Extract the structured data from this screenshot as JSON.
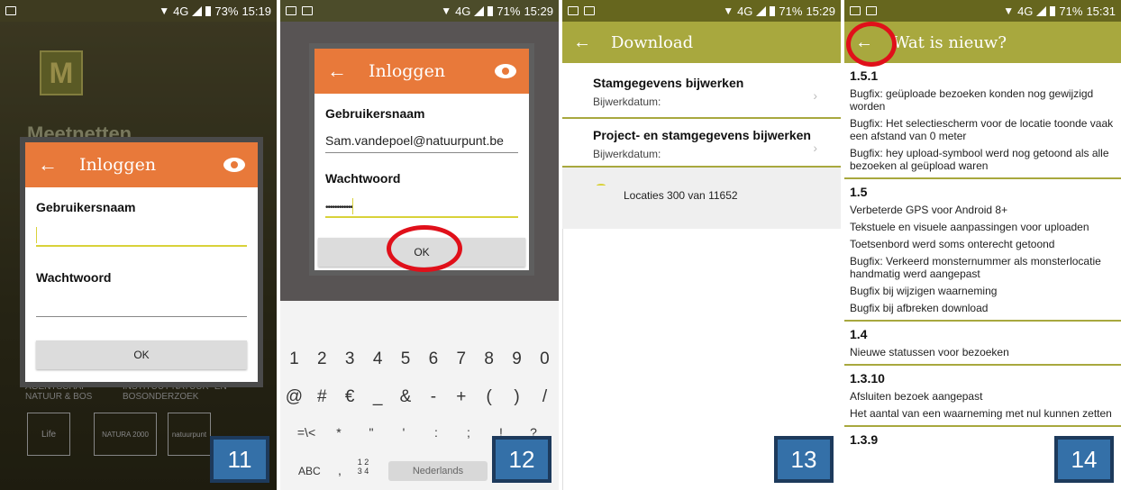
{
  "status_bars": [
    {
      "battery": "73%",
      "time": "15:19",
      "network": "4G"
    },
    {
      "battery": "71%",
      "time": "15:29",
      "network": "4G"
    },
    {
      "battery": "71%",
      "time": "15:29",
      "network": "4G"
    },
    {
      "battery": "71%",
      "time": "15:31",
      "network": "4G"
    }
  ],
  "panel1": {
    "tag": "11",
    "app_logo": "M",
    "app_title": "Meetnetten",
    "org_left": "AGENTSCHAP NATUUR & BOS",
    "org_right": "INSTITUUT NATUUR- EN BOSONDERZOEK",
    "badge1": "Life",
    "badge2": "NATURA 2000",
    "badge3": "natuurpunt",
    "dialog": {
      "back": "←",
      "title": "Inloggen",
      "username_label": "Gebruikersnaam",
      "username_value": "",
      "password_label": "Wachtwoord",
      "password_value": "",
      "ok_label": "OK"
    }
  },
  "panel2": {
    "tag": "12",
    "dialog": {
      "back": "←",
      "title": "Inloggen",
      "username_label": "Gebruikersnaam",
      "username_value": "Sam.vandepoel@natuurpunt.be",
      "password_label": "Wachtwoord",
      "password_value": "••••••••••••",
      "ok_label": "OK"
    },
    "keyboard": {
      "row1": [
        "1",
        "2",
        "3",
        "4",
        "5",
        "6",
        "7",
        "8",
        "9",
        "0"
      ],
      "row2": [
        "@",
        "#",
        "€",
        "_",
        "&",
        "-",
        "+",
        "(",
        ")",
        "/"
      ],
      "row3": [
        "=\\<",
        "*",
        "\"",
        "'",
        ":",
        ";",
        "!",
        "?"
      ],
      "abc": "ABC",
      "comma": ",",
      "fraction": "1 2 3 4",
      "language": "Nederlands"
    }
  },
  "panel3": {
    "tag": "13",
    "back": "←",
    "title": "Download",
    "items": [
      {
        "title": "Stamgegevens bijwerken",
        "sub": "Bijwerkdatum:"
      },
      {
        "title": "Project- en stamgegevens bijwerken",
        "sub": "Bijwerkdatum:"
      }
    ],
    "progress_text": "Locaties 300 van 11652"
  },
  "panel4": {
    "tag": "14",
    "back": "←",
    "title": "Wat is nieuw?",
    "versions": [
      {
        "v": "1.5.1",
        "notes": [
          "Bugfix: geüploade bezoeken konden nog gewijzigd worden",
          "Bugfix: Het selectiescherm voor de locatie toonde vaak een afstand van 0 meter",
          "Bugfix: hey upload-symbool werd nog getoond als alle bezoeken al geüpload waren"
        ]
      },
      {
        "v": "1.5",
        "notes": [
          "Verbeterde GPS voor Android 8+",
          "Tekstuele en visuele aanpassingen voor uploaden",
          "Toetsenbord werd soms onterecht getoond",
          "Bugfix: Verkeerd monsternummer als monsterlocatie handmatig werd aangepast",
          "Bugfix bij wijzigen waarneming",
          "Bugfix bij afbreken download"
        ]
      },
      {
        "v": "1.4",
        "notes": [
          "Nieuwe statussen voor bezoeken"
        ]
      },
      {
        "v": "1.3.10",
        "notes": [
          "Afsluiten bezoek aangepast",
          "Het aantal van een waarneming met nul kunnen zetten"
        ]
      },
      {
        "v": "1.3.9",
        "notes": []
      }
    ]
  }
}
